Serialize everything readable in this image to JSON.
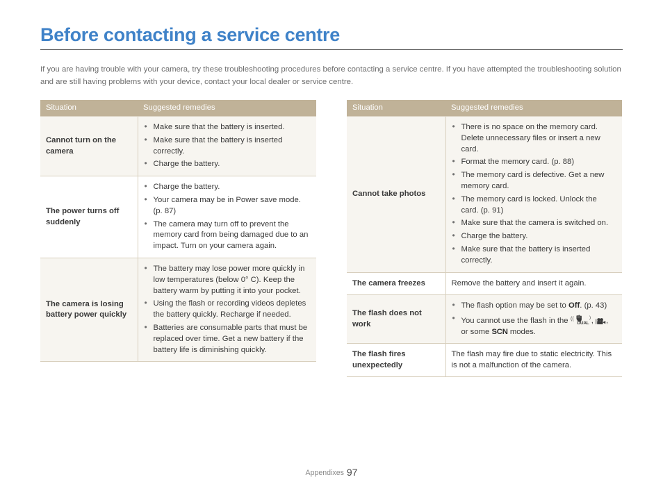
{
  "page_title": "Before contacting a service centre",
  "intro": "If you are having trouble with your camera, try these troubleshooting procedures before contacting a service centre. If you have attempted the troubleshooting solution and are still having problems with your device, contact your local dealer or service centre.",
  "colors": {
    "title_blue": "#3f82c8",
    "header_tan": "#c0b298",
    "row_shade": "#f7f5f0",
    "border": "#d8cfbd",
    "body_text": "#6e6e6e"
  },
  "tables": {
    "left": {
      "headers": {
        "situation": "Situation",
        "remedies": "Suggested remedies"
      },
      "rows": [
        {
          "situation": "Cannot turn on the camera",
          "remedies": [
            "Make sure that the battery is inserted.",
            "Make sure that the battery is inserted correctly.",
            "Charge the battery."
          ]
        },
        {
          "situation": "The power turns off suddenly",
          "remedies": [
            "Charge the battery.",
            "Your camera may be in Power save mode. (p. 87)",
            "The camera may turn off to prevent the memory card from being damaged due to an impact. Turn on your camera again."
          ]
        },
        {
          "situation": "The camera is losing battery power quickly",
          "remedies": [
            "The battery may lose power more quickly in low temperatures (below 0° C). Keep the battery warm by putting it into your pocket.",
            "Using the flash or recording videos depletes the battery quickly. Recharge if needed.",
            "Batteries are consumable parts that must be replaced over time. Get a new battery if the battery life is diminishing quickly."
          ]
        }
      ]
    },
    "right": {
      "headers": {
        "situation": "Situation",
        "remedies": "Suggested remedies"
      },
      "rows": [
        {
          "situation": "Cannot take photos",
          "remedies": [
            "There is no space on the memory card. Delete unnecessary files or insert a new card.",
            "Format the memory card. (p. 88)",
            "The memory card is defective. Get a new memory card.",
            "The memory card is locked. Unlock the card. (p. 91)",
            "Make sure that the camera is switched on.",
            "Charge the battery.",
            "Make sure that the battery is inserted correctly."
          ]
        },
        {
          "situation": "The camera freezes",
          "plain_remedy": "Remove the battery and insert it again."
        },
        {
          "situation": "The flash does not work",
          "remedies_rich": [
            {
              "parts": [
                {
                  "t": "text",
                  "v": "The flash option may be set to "
                },
                {
                  "t": "bold",
                  "v": "Off"
                },
                {
                  "t": "text",
                  "v": ". (p. 43)"
                }
              ]
            },
            {
              "parts": [
                {
                  "t": "text",
                  "v": "You cannot use the flash in the "
                },
                {
                  "t": "icon",
                  "v": "dual-is-icon"
                },
                {
                  "t": "text",
                  "v": ", "
                },
                {
                  "t": "icon",
                  "v": "movie-camera-icon"
                },
                {
                  "t": "text",
                  "v": ", or some "
                },
                {
                  "t": "scn",
                  "v": "SCN"
                },
                {
                  "t": "text",
                  "v": " modes."
                }
              ]
            }
          ]
        },
        {
          "situation": "The flash fires unexpectedly",
          "plain_remedy": "The flash may fire due to static electricity. This is not a malfunction of the camera."
        }
      ]
    }
  },
  "footer": {
    "label": "Appendixes",
    "page_number": "97"
  }
}
